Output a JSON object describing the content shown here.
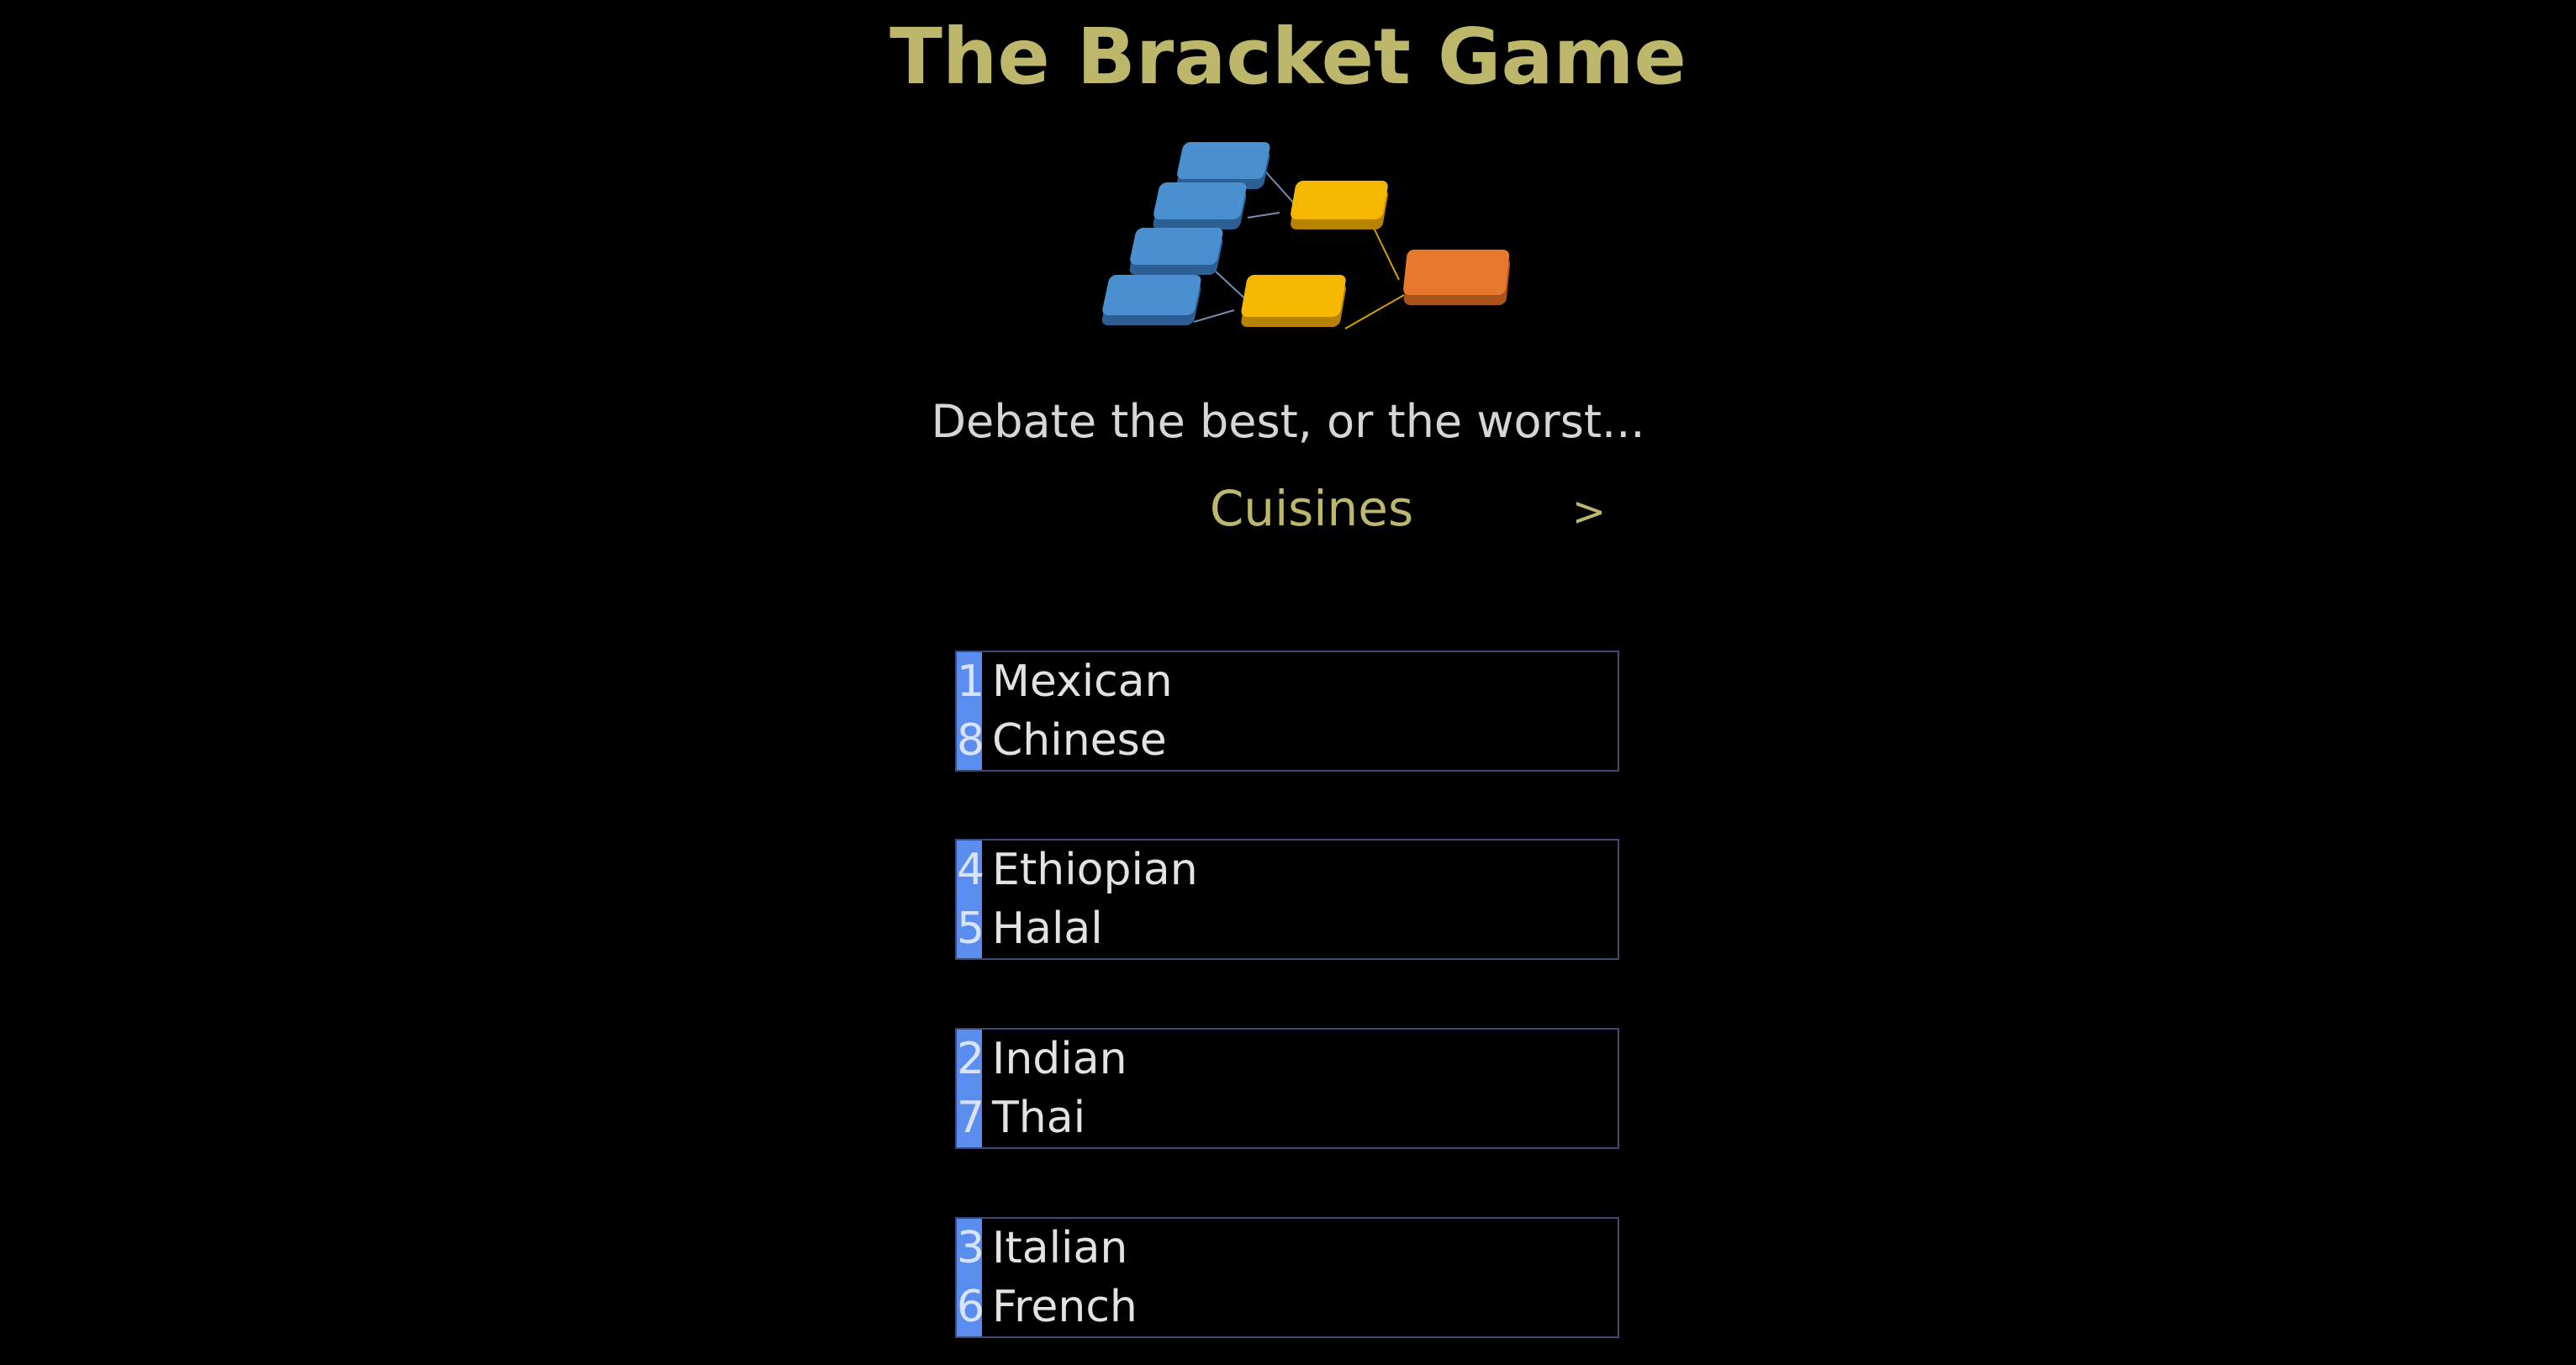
{
  "app": {
    "title": "The Bracket Game",
    "tagline": "Debate the best, or the worst..."
  },
  "category": {
    "name": "Cuisines",
    "next_label": ">"
  },
  "logo": {
    "colors": {
      "blue": "#4a8fd0",
      "yellow": "#f5b700",
      "orange": "#e8782c"
    }
  },
  "colors": {
    "title": "#bdb76b",
    "seed_background": "#5b8def",
    "matchup_border": "#3c4a7a",
    "background": "#000000"
  },
  "matchups": [
    {
      "teams": [
        {
          "seed": "1",
          "name": "Mexican"
        },
        {
          "seed": "8",
          "name": "Chinese"
        }
      ]
    },
    {
      "teams": [
        {
          "seed": "4",
          "name": "Ethiopian"
        },
        {
          "seed": "5",
          "name": "Halal"
        }
      ]
    },
    {
      "teams": [
        {
          "seed": "2",
          "name": "Indian"
        },
        {
          "seed": "7",
          "name": "Thai"
        }
      ]
    },
    {
      "teams": [
        {
          "seed": "3",
          "name": "Italian"
        },
        {
          "seed": "6",
          "name": "French"
        }
      ]
    }
  ]
}
